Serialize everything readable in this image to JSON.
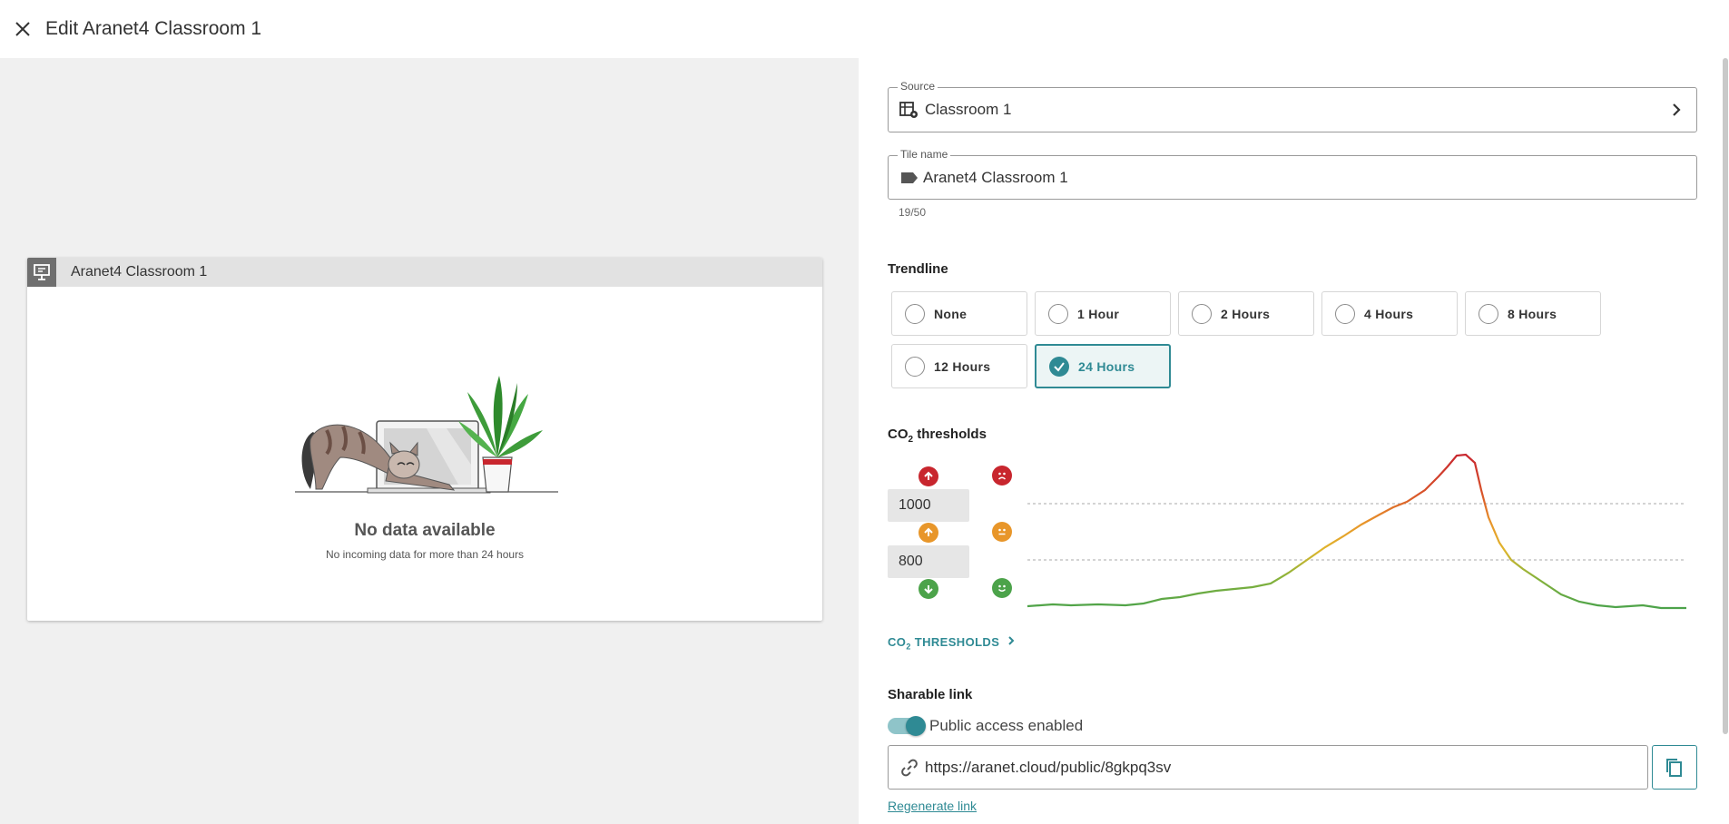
{
  "header": {
    "title": "Edit Aranet4 Classroom 1"
  },
  "preview": {
    "tile_title": "Aranet4 Classroom 1",
    "nodata_title": "No data available",
    "nodata_subtitle": "No incoming data for more than 24 hours"
  },
  "source": {
    "label": "Source",
    "value": "Classroom 1"
  },
  "tile_name": {
    "label": "Tile name",
    "value": "Aranet4 Classroom 1",
    "counter": "19/50"
  },
  "trendline": {
    "label": "Trendline",
    "options": [
      {
        "label": "None",
        "selected": false
      },
      {
        "label": "1 Hour",
        "selected": false
      },
      {
        "label": "2 Hours",
        "selected": false
      },
      {
        "label": "4 Hours",
        "selected": false
      },
      {
        "label": "8 Hours",
        "selected": false
      },
      {
        "label": "12 Hours",
        "selected": false
      },
      {
        "label": "24 Hours",
        "selected": true
      }
    ]
  },
  "co2": {
    "label_prefix": "CO",
    "label_sub": "2",
    "label_suffix": " thresholds",
    "high_value": "1000",
    "low_value": "800",
    "link_prefix": "CO",
    "link_sub": "2",
    "link_suffix": " THRESHOLDS",
    "colors": {
      "high": "#c8262e",
      "mid": "#e8962a",
      "low": "#4ca34a"
    }
  },
  "share": {
    "label": "Sharable link",
    "toggle_label": "Public access enabled",
    "toggle_on": true,
    "url": "https://aranet.cloud/public/8gkpq3sv",
    "regenerate_label": "Regenerate link"
  },
  "colors": {
    "accent": "#2f8a94"
  }
}
